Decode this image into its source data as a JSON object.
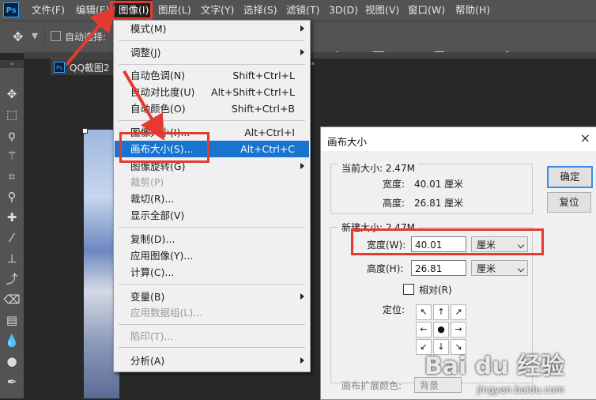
{
  "menubar": {
    "logo": "Ps",
    "items": [
      "文件(F)",
      "编辑(E)",
      "图像(I)",
      "图层(L)",
      "文字(Y)",
      "选择(S)",
      "滤镜(T)",
      "3D(D)",
      "视图(V)",
      "窗口(W)",
      "帮助(H)"
    ],
    "active_index": 2
  },
  "optbar": {
    "auto_select_label": "自动选择:"
  },
  "doc": {
    "tab_title": "QQ截图2"
  },
  "image_menu": {
    "items": [
      {
        "label": "模式(M)",
        "shortcut": "",
        "submenu": true
      },
      {
        "label": "调整(J)",
        "shortcut": "",
        "submenu": true
      },
      {
        "label": "自动色调(N)",
        "shortcut": "Shift+Ctrl+L"
      },
      {
        "label": "自动对比度(U)",
        "shortcut": "Alt+Shift+Ctrl+L"
      },
      {
        "label": "自动颜色(O)",
        "shortcut": "Shift+Ctrl+B"
      },
      {
        "label": "图像大小(I)...",
        "shortcut": "Alt+Ctrl+I"
      },
      {
        "label": "画布大小(S)...",
        "shortcut": "Alt+Ctrl+C",
        "highlighted": true
      },
      {
        "label": "图像旋转(G)",
        "shortcut": "",
        "submenu": true
      },
      {
        "label": "裁剪(P)",
        "shortcut": "",
        "disabled": true
      },
      {
        "label": "裁切(R)...",
        "shortcut": ""
      },
      {
        "label": "显示全部(V)",
        "shortcut": ""
      },
      {
        "label": "复制(D)...",
        "shortcut": ""
      },
      {
        "label": "应用图像(Y)...",
        "shortcut": ""
      },
      {
        "label": "计算(C)...",
        "shortcut": ""
      },
      {
        "label": "变量(B)",
        "shortcut": "",
        "submenu": true
      },
      {
        "label": "应用数据组(L)...",
        "shortcut": "",
        "disabled": true
      },
      {
        "label": "陷印(T)...",
        "shortcut": "",
        "disabled": true
      },
      {
        "label": "分析(A)",
        "shortcut": "",
        "submenu": true
      }
    ]
  },
  "dialog": {
    "title": "画布大小",
    "close": "×",
    "current_group": "当前大小: 2.47M",
    "current_width_label": "宽度:",
    "current_width_value": "40.01 厘米",
    "current_height_label": "高度:",
    "current_height_value": "26.81 厘米",
    "new_group": "新建大小: 2.47M",
    "width_label": "宽度(W):",
    "width_value": "40.01",
    "width_unit": "厘米",
    "height_label": "高度(H):",
    "height_value": "26.81",
    "height_unit": "厘米",
    "relative_label": "相对(R)",
    "anchor_label": "定位:",
    "anchors": [
      "↖",
      "↑",
      "↗",
      "←",
      "●",
      "→",
      "↙",
      "↓",
      "↘"
    ],
    "ok": "确定",
    "reset": "复位",
    "ext_color_label": "画布扩展颜色:",
    "ext_color_value": "背景"
  },
  "watermark": {
    "brand": "Bai du 经验",
    "url": "jingyan.baidu.com"
  },
  "colors": {
    "highlight": "#1874cf",
    "annotation_red": "#e53a2f"
  }
}
